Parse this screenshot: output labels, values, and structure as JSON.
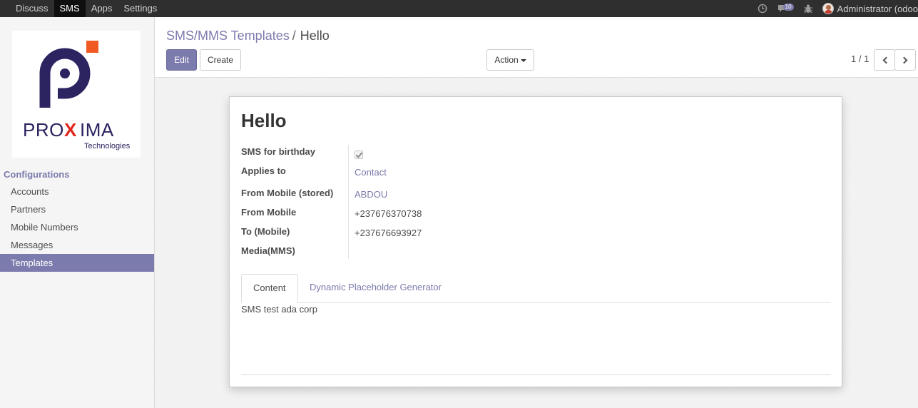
{
  "topbar": {
    "menu": [
      "Discuss",
      "SMS",
      "Apps",
      "Settings"
    ],
    "active_menu": "SMS",
    "message_count": "10",
    "user_name": "Administrator (odoo"
  },
  "sidebar": {
    "logo": {
      "line1": "PROXIMA",
      "line2": "Technologies"
    },
    "section": "Configurations",
    "items": [
      "Accounts",
      "Partners",
      "Mobile Numbers",
      "Messages",
      "Templates"
    ],
    "active_item": "Templates"
  },
  "breadcrumb": {
    "parent": "SMS/MMS Templates",
    "separator": "/",
    "current": "Hello"
  },
  "buttons": {
    "edit": "Edit",
    "create": "Create",
    "action": "Action"
  },
  "pager": {
    "value": "1 / 1"
  },
  "record": {
    "title": "Hello",
    "fields": [
      {
        "label": "SMS for birthday",
        "value": ""
      },
      {
        "label": "Applies to",
        "value": "Contact"
      },
      {
        "label": "From Mobile (stored)",
        "value": "ABDOU"
      },
      {
        "label": "From Mobile",
        "value": "+237676370738"
      },
      {
        "label": "To (Mobile)",
        "value": "+237676693927"
      },
      {
        "label": "Media(MMS)",
        "value": ""
      }
    ],
    "sms_for_birthday_checked": true,
    "tabs": [
      "Content",
      "Dynamic Placeholder Generator"
    ],
    "active_tab": "Content",
    "content": "SMS test ada corp"
  },
  "colors": {
    "accent": "#7c7bad",
    "topbar": "#2f2f2f",
    "logo_purple": "#2b2461",
    "logo_orange": "#f05a22",
    "logo_red": "#e3261b"
  }
}
